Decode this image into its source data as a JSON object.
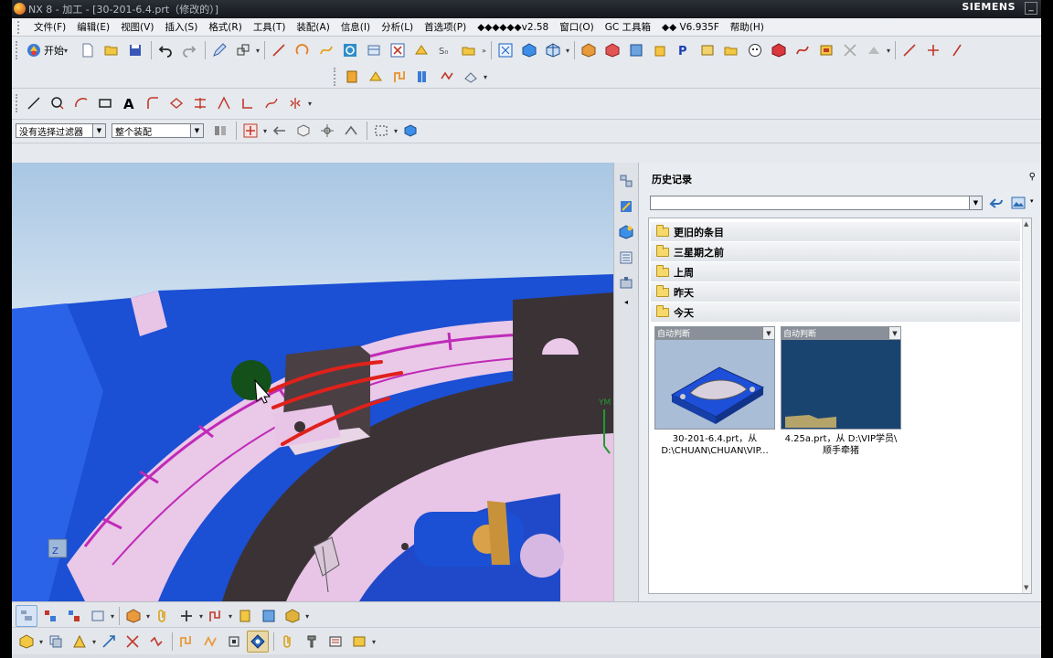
{
  "window": {
    "title": "NX 8 - 加工 - [30-201-6.4.prt（修改的）]",
    "brand": "SIEMENS",
    "minimize_label": "_"
  },
  "menu": {
    "items": [
      "文件(F)",
      "编辑(E)",
      "视图(V)",
      "插入(S)",
      "格式(R)",
      "工具(T)",
      "装配(A)",
      "信息(I)",
      "分析(L)",
      "首选项(P)",
      "◆◆◆◆◆◆v2.58",
      "窗口(O)",
      "GC 工具箱",
      "◆◆ V6.935F",
      "帮助(H)"
    ]
  },
  "toolbar": {
    "start_label": "开始"
  },
  "selection": {
    "filter_value": "没有选择过滤器",
    "scope_value": "整个装配"
  },
  "history": {
    "title": "历史记录",
    "groups": [
      "更旧的条目",
      "三星期之前",
      "上周",
      "昨天",
      "今天"
    ],
    "cards": [
      {
        "header": "自动判断",
        "caption1": "30-201-6.4.prt，从",
        "caption2": "D:\\CHUAN\\CHUAN\\VIP..."
      },
      {
        "header": "自动判断",
        "caption1": "4.25a.prt，从 D:\\VIP学员\\",
        "caption2": "顺手牵猪"
      }
    ]
  },
  "colors": {
    "model_blue": "#1b4fd4",
    "model_pink": "#e8c4e6",
    "model_magenta": "#c02ab8",
    "cavity_dark": "#3b3236",
    "annotation_red": "#e0211b"
  }
}
